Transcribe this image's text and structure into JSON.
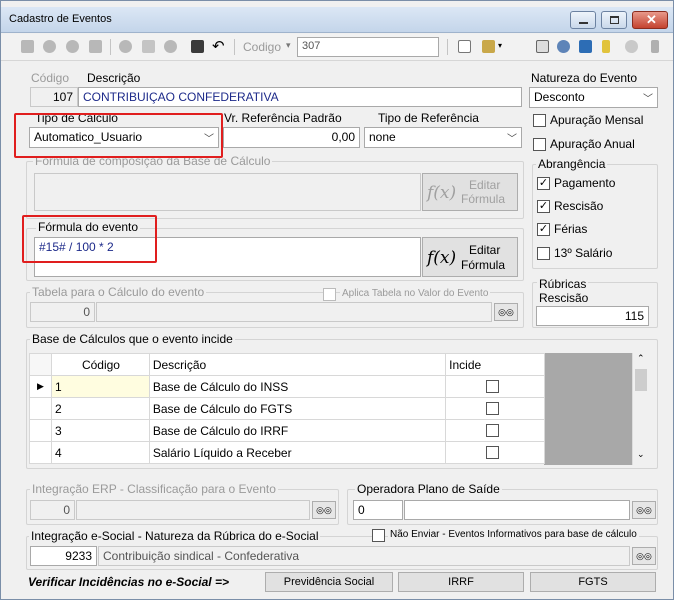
{
  "window": {
    "title": "Cadastro de Eventos"
  },
  "toolbar": {
    "codigo_label": "Codigo",
    "codigo_value": "307"
  },
  "form": {
    "codigo_label": "Código",
    "descricao_label": "Descrição",
    "codigo_value": "107",
    "descricao_value": "CONTRIBUIÇAO CONFEDERATIVA",
    "natureza_label": "Natureza do Evento",
    "natureza_value": "Desconto",
    "tipo_calculo_label": "Tipo de Cálculo",
    "tipo_calculo_value": "Automatico_Usuario",
    "vr_referencia_label": "Vr. Referência Padrão",
    "vr_referencia_value": "0,00",
    "tipo_referencia_label": "Tipo de Referência",
    "tipo_referencia_value": "none",
    "apuracao_mensal": "Apuração Mensal",
    "apuracao_anual": "Apuração Anual",
    "formula_base_label": "Fórmula de composição da Base de Cálculo",
    "formula_evento_label": "Fórmula do evento",
    "formula_evento_value": "#15# / 100 * 2",
    "editar_label": "Editar",
    "formula_label": "Fórmula",
    "fx_symbol": "f(x)",
    "abrangencia_label": "Abrangência",
    "pagamento": "Pagamento",
    "rescisao": "Rescisão",
    "ferias": "Férias",
    "decimo": "13º Salário",
    "rubricas_rescisao_label_1": "Rúbricas",
    "rubricas_rescisao_label_2": "Rescisão",
    "rubricas_rescisao_value": "115",
    "tabela_calculo_label": "Tabela para o Cálculo do evento",
    "tabela_calculo_value": "0",
    "aplica_tabela_label": "Aplica Tabela no Valor do Evento",
    "base_calculos_label": "Base de Cálculos que o evento incide"
  },
  "grid": {
    "headers": {
      "codigo": "Código",
      "descricao": "Descrição",
      "incide": "Incide"
    },
    "rows": [
      {
        "codigo": "1",
        "descricao": "Base de Cálculo do INSS"
      },
      {
        "codigo": "2",
        "descricao": "Base de Cálculo do FGTS"
      },
      {
        "codigo": "3",
        "descricao": "Base de Cálculo do IRRF"
      },
      {
        "codigo": "4",
        "descricao": "Salário Líquido a Receber"
      }
    ]
  },
  "integracao_erp": {
    "label": "Integração ERP - Classificação para o Evento",
    "value": "0"
  },
  "operadora": {
    "label": "Operadora Plano de Saíde",
    "value": "0"
  },
  "esocial": {
    "label": "Integração e-Social - Natureza da Rúbrica do e-Social",
    "nao_enviar_label": "Não Enviar - Eventos Informativos para base de cálculo",
    "code": "9233",
    "desc": "Contribuição sindical - Confederativa"
  },
  "footer": {
    "verificar_label": "Verificar Incidências no e-Social =>",
    "previdencia": "Previdência Social",
    "irrf": "IRRF",
    "fgts": "FGTS"
  },
  "colors": {
    "highlight": "#e01e1e",
    "selection_cell": "#fffde0",
    "grid_side": "#a8a8a8"
  }
}
